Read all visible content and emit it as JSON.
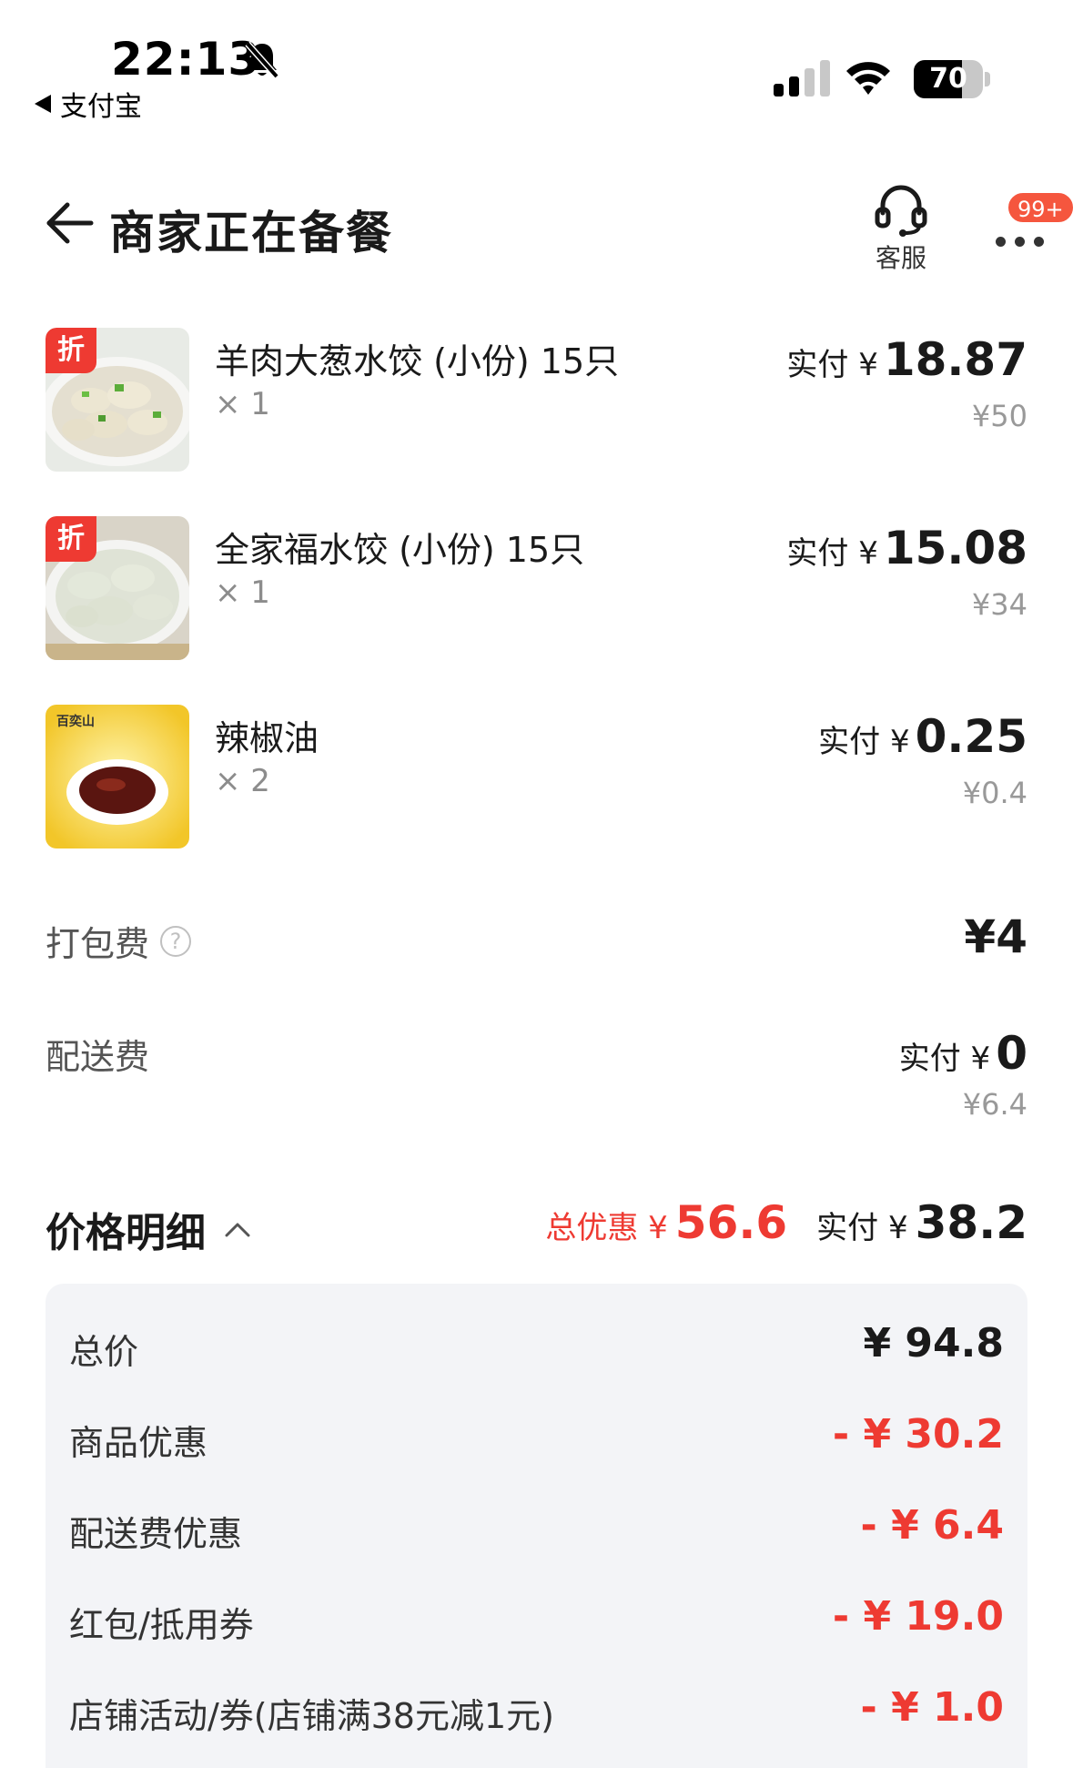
{
  "status_bar": {
    "time": "22:13",
    "back_app": "支付宝",
    "battery_level": 70,
    "battery_text": "70"
  },
  "header": {
    "title": "商家正在备餐",
    "service_label": "客服",
    "badge": "99+"
  },
  "items": [
    {
      "name": "羊肉大葱水饺 (小份) 15只",
      "qty": "× 1",
      "pay_label": "实付 ¥",
      "pay_amount": "18.87",
      "original": "¥50",
      "tag": "折",
      "image": "dumplings-plate"
    },
    {
      "name": "全家福水饺 (小份) 15只",
      "qty": "× 1",
      "pay_label": "实付 ¥",
      "pay_amount": "15.08",
      "original": "¥34",
      "tag": "折",
      "image": "dumplings-plate"
    },
    {
      "name": "辣椒油",
      "qty": "× 2",
      "pay_label": "实付 ¥",
      "pay_amount": "0.25",
      "original": "¥0.4",
      "tag": "",
      "image": "chili-oil-bowl",
      "image_brand": "百奕山"
    }
  ],
  "fees": {
    "packing_label": "打包费",
    "packing_value": "¥4",
    "delivery_label": "配送费",
    "delivery_pay_label": "实付 ¥",
    "delivery_pay_amount": "0",
    "delivery_original": "¥6.4"
  },
  "price_detail": {
    "title": "价格明细",
    "total_discount_label": "总优惠 ¥",
    "total_discount_amount": "56.6",
    "pay_label": "实付 ¥",
    "pay_amount": "38.2",
    "rows": [
      {
        "label": "总价",
        "value": "¥ 94.8"
      },
      {
        "label": "商品优惠",
        "value": "- ¥ 30.2"
      },
      {
        "label": "配送费优惠",
        "value": "- ¥ 6.4"
      },
      {
        "label": "红包/抵用券",
        "value": "- ¥ 19.0"
      },
      {
        "label": "店铺活动/券(店铺满38元减1元)",
        "value": "- ¥ 1.0"
      }
    ]
  },
  "colors": {
    "accent_red": "#ee3a32",
    "badge": "#f5563e",
    "panel_bg": "#f3f4f7"
  }
}
